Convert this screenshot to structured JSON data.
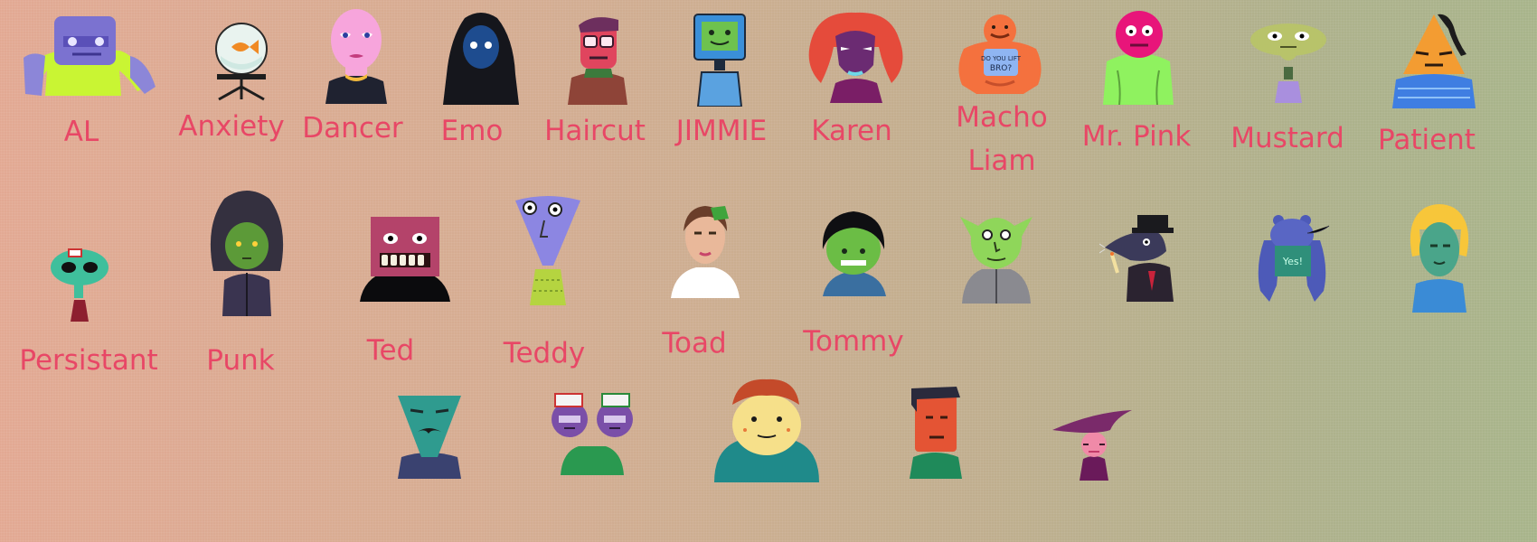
{
  "characters": [
    {
      "name": "AL",
      "icon": "blocky-purple-man-icon"
    },
    {
      "name": "Anxiety",
      "icon": "goldfish-bowl-icon"
    },
    {
      "name": "Dancer",
      "icon": "pink-bald-woman-icon"
    },
    {
      "name": "Emo",
      "icon": "hooded-figure-icon"
    },
    {
      "name": "Haircut",
      "icon": "red-face-man-icon"
    },
    {
      "name": "JIMMIE",
      "icon": "computer-monitor-robot-icon"
    },
    {
      "name": "Karen",
      "icon": "red-hair-woman-icon"
    },
    {
      "name": "Macho Liam",
      "icon": "muscle-man-icon"
    },
    {
      "name": "Mr. Pink",
      "icon": "pink-head-green-sweater-icon"
    },
    {
      "name": "Mustard",
      "icon": "olive-alien-icon"
    },
    {
      "name": "Patient",
      "icon": "orange-triangle-head-icon"
    },
    {
      "name": "Persistant",
      "icon": "teal-alien-icon"
    },
    {
      "name": "Punk",
      "icon": "green-punk-icon"
    },
    {
      "name": "Ted",
      "icon": "box-head-teeth-icon"
    },
    {
      "name": "Teddy",
      "icon": "cone-head-icon"
    },
    {
      "name": "Toad",
      "icon": "young-man-icon"
    },
    {
      "name": "Tommy",
      "icon": "green-boy-beanie-icon"
    },
    {
      "name": "",
      "icon": "goblin-icon"
    },
    {
      "name": "",
      "icon": "rat-gangster-icon"
    },
    {
      "name": "",
      "icon": "blue-muscle-creature-icon"
    },
    {
      "name": "",
      "icon": "blonde-green-woman-icon"
    },
    {
      "name": "",
      "icon": "mustache-teal-man-icon"
    },
    {
      "name": "",
      "icon": "purple-twins-icon"
    },
    {
      "name": "",
      "icon": "yellow-big-woman-icon"
    },
    {
      "name": "",
      "icon": "red-man-icon"
    },
    {
      "name": "",
      "icon": "witch-icon"
    }
  ]
}
